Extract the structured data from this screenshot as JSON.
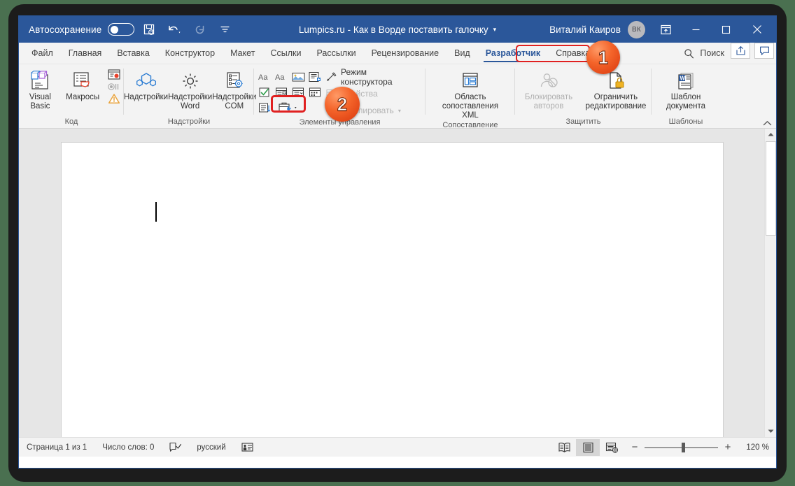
{
  "titlebar": {
    "autosave_label": "Автосохранение",
    "autosave_state": "off",
    "save_icon": "save-icon",
    "undo_icon": "undo-icon",
    "redo_icon": "redo-icon",
    "customize_icon": "customize-quick-access-icon",
    "document_title": "Lumpics.ru - Как в Ворде поставить галочку",
    "title_caret": "▾",
    "user_name": "Виталий Каиров",
    "avatar_initials": "ВК",
    "ribbon_display_icon": "ribbon-display-options-icon",
    "minimize_label": "—",
    "maximize_label": "☐",
    "close_label": "✕",
    "bar_color": "#2b579a"
  },
  "tabs": [
    {
      "label": "Файл",
      "active": false
    },
    {
      "label": "Главная",
      "active": false
    },
    {
      "label": "Вставка",
      "active": false
    },
    {
      "label": "Конструктор",
      "active": false
    },
    {
      "label": "Макет",
      "active": false
    },
    {
      "label": "Ссылки",
      "active": false
    },
    {
      "label": "Рассылки",
      "active": false
    },
    {
      "label": "Рецензирование",
      "active": false
    },
    {
      "label": "Вид",
      "active": false
    },
    {
      "label": "Разработчик",
      "active": true
    },
    {
      "label": "Справка",
      "active": false
    }
  ],
  "tabbar_right": {
    "search_icon": "search-icon",
    "search_label": "Поиск",
    "share_icon": "share-icon",
    "comments_icon": "comments-icon"
  },
  "ribbon": {
    "groups": [
      {
        "name": "Код",
        "buttons": [
          {
            "label": "Visual Basic",
            "icon": "visual-basic-icon",
            "disabled": false
          },
          {
            "label": "Макросы",
            "icon": "macros-icon",
            "disabled": false
          }
        ],
        "mini_icons": [
          {
            "icon": "record-macro-icon"
          },
          {
            "icon": "pause-recording-icon"
          },
          {
            "icon": "macro-security-icon"
          }
        ]
      },
      {
        "name": "Надстройки",
        "buttons": [
          {
            "label": "Надстройки",
            "icon": "addins-store-icon",
            "disabled": false
          },
          {
            "label": "Надстройки Word",
            "icon": "word-addins-icon",
            "disabled": false
          },
          {
            "label": "Надстройки COM",
            "icon": "com-addins-icon",
            "disabled": false
          }
        ]
      },
      {
        "name": "Элементы управления",
        "control_grid": [
          "rich-text-content-control-icon",
          "plain-text-content-control-icon",
          "picture-content-control-icon",
          "building-block-gallery-icon",
          "checkbox-content-control-icon",
          "combo-box-content-control-icon",
          "dropdown-list-content-control-icon",
          "date-picker-content-control-icon",
          "repeating-section-content-control-icon",
          "legacy-tools-icon"
        ],
        "side_items": [
          {
            "label": "Режим конструктора",
            "icon": "design-mode-icon",
            "disabled": false
          },
          {
            "label": "Свойства",
            "icon": "properties-icon",
            "disabled": true
          },
          {
            "label": "Группировать",
            "icon": "group-icon",
            "disabled": true,
            "caret": "▾"
          }
        ]
      },
      {
        "name": "Сопоставление",
        "buttons": [
          {
            "label": "Область сопоставления XML",
            "icon": "xml-mapping-pane-icon",
            "disabled": false
          }
        ]
      },
      {
        "name": "Защитить",
        "buttons": [
          {
            "label": "Блокировать авторов",
            "icon": "block-authors-icon",
            "disabled": true,
            "caret": "▾"
          },
          {
            "label": "Ограничить редактирование",
            "icon": "restrict-editing-icon",
            "disabled": false
          }
        ]
      },
      {
        "name": "Шаблоны",
        "buttons": [
          {
            "label": "Шаблон документа",
            "icon": "document-template-icon",
            "disabled": false
          }
        ]
      }
    ],
    "collapse_icon": "collapse-ribbon-icon"
  },
  "badges": [
    {
      "number": "1",
      "target": "developer-tab"
    },
    {
      "number": "2",
      "target": "legacy-tools-button"
    }
  ],
  "document": {
    "caret_visible": true
  },
  "scrollbar": {
    "up_arrow_icon": "scroll-up-icon",
    "down_arrow_icon": "scroll-down-icon"
  },
  "statusbar": {
    "page_info": "Страница 1 из 1",
    "word_count": "Число слов: 0",
    "proofing_icon": "proofing-errors-icon",
    "language": "русский",
    "accessibility_icon": "accessibility-checker-icon",
    "views": [
      {
        "icon": "read-mode-icon",
        "selected": false
      },
      {
        "icon": "print-layout-icon",
        "selected": true
      },
      {
        "icon": "web-layout-icon",
        "selected": false
      }
    ],
    "zoom_out": "−",
    "zoom_in": "+",
    "zoom_value": "120 %"
  },
  "colors": {
    "word_blue": "#2b579a",
    "ribbon_bg": "#f3f3f3",
    "highlight_red": "#e02020",
    "badge_orange": "#f4642a",
    "desktop_green": "#4a7050"
  }
}
